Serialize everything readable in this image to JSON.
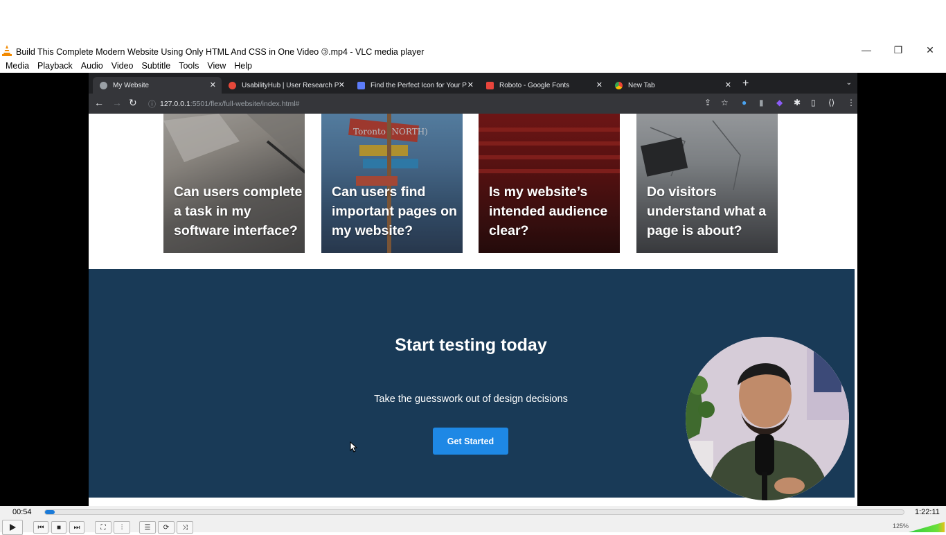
{
  "window": {
    "title": "Build This Complete Modern Website Using Only HTML And CSS in One Video 🄯.mp4 - VLC media player",
    "minimize": "—",
    "maximize": "❐",
    "close": "✕"
  },
  "menu": [
    "Media",
    "Playback",
    "Audio",
    "Video",
    "Subtitle",
    "Tools",
    "View",
    "Help"
  ],
  "browser": {
    "tabs": [
      {
        "label": "My Website",
        "active": true,
        "favicon_color": "#9aa0a6"
      },
      {
        "label": "UsabilityHub | User Research P",
        "active": false,
        "favicon_color": "#e5483a"
      },
      {
        "label": "Find the Perfect Icon for Your P",
        "active": false,
        "favicon_color": "#5c7cfa"
      },
      {
        "label": "Roboto - Google Fonts",
        "active": false,
        "favicon_color": "#e8453c"
      },
      {
        "label": "New Tab",
        "active": false,
        "favicon_color": "#e8eaed"
      }
    ],
    "url_host": "127.0.0.1",
    "url_path": ":5501/flex/full-website/index.html#"
  },
  "page": {
    "cards": [
      {
        "text": "Can users complete a task in my software interface?"
      },
      {
        "text": "Can users find important pages on my website?"
      },
      {
        "text": "Is my website’s intended audience clear?"
      },
      {
        "text": "Do visitors understand what a page is about?"
      }
    ],
    "cta": {
      "title": "Start testing today",
      "subtitle": "Take the guesswork out of design decisions",
      "button": "Get Started"
    }
  },
  "player": {
    "elapsed": "00:54",
    "total": "1:22:11",
    "progress_fraction": 0.011,
    "volume": "125%"
  },
  "colors": {
    "cta_background": "#193a57",
    "button": "#1e88e5",
    "seek_fill": "#1a7ad8"
  }
}
